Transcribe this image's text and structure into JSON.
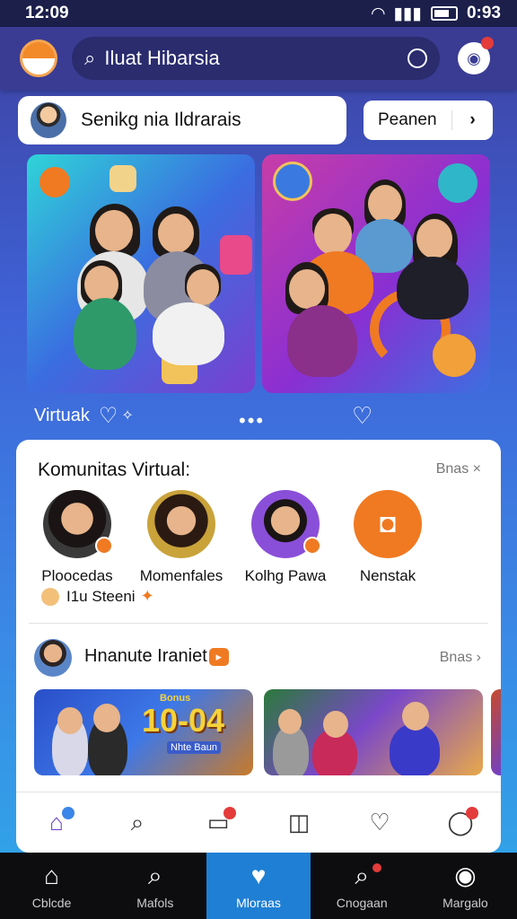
{
  "status_bar": {
    "time": "12:09",
    "clock_right": "0:93"
  },
  "app_bar": {
    "search_text": "Iluat Hibarsia"
  },
  "greeting": {
    "text": "Senikg nia  Ildrarais"
  },
  "pill_button": {
    "label": "Peanen",
    "chevron": "›"
  },
  "featured_cards": [
    {
      "meta_label": "Virtuak",
      "liked": false
    },
    {
      "liked": false
    }
  ],
  "pager": {
    "dots": "•••"
  },
  "community": {
    "title": "Komunitas Virtual:",
    "link": "Bnas ×",
    "members": [
      {
        "name": "Ploocedas",
        "badge": true
      },
      {
        "name": "Momenfales",
        "badge": false
      },
      {
        "name": "Kolhg Pawa",
        "badge": true
      },
      {
        "name": "Nenstak",
        "icon": "bag-icon"
      }
    ],
    "sub_text": "I1u Steeni"
  },
  "featured_section": {
    "title": "Hnanute Iraniet",
    "link": "Bnas ›",
    "thumbs": [
      {
        "headline": "10-04",
        "caption": "Bonus",
        "sub": "Nhte Baun"
      },
      {},
      {}
    ]
  },
  "inner_tabs": [
    {
      "icon": "home-icon",
      "active": true,
      "badge": "blue"
    },
    {
      "icon": "search-icon"
    },
    {
      "icon": "chat-icon",
      "badge": "red"
    },
    {
      "icon": "bag-icon"
    },
    {
      "icon": "heart-icon"
    },
    {
      "icon": "profile-icon",
      "badge": "red"
    }
  ],
  "bottom_nav": [
    {
      "label": "Cblcde",
      "icon": "home-icon"
    },
    {
      "label": "Mafols",
      "icon": "search-icon"
    },
    {
      "label": "Mloraas",
      "icon": "heart-icon",
      "active": true
    },
    {
      "label": "Cnogaan",
      "icon": "chat-search-icon",
      "badge": true
    },
    {
      "label": "Margalo",
      "icon": "profile-icon"
    }
  ],
  "colors": {
    "accent_orange": "#f07a22",
    "active_blue": "#1f7fd4",
    "appbar": "#3a3c93",
    "badge_red": "#e43b3b"
  }
}
